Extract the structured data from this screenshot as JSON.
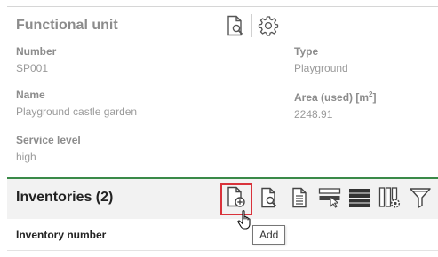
{
  "functional_unit": {
    "title": "Functional unit",
    "fields": {
      "number": {
        "label": "Number",
        "value": "SP001"
      },
      "type": {
        "label": "Type",
        "value": "Playground"
      },
      "name": {
        "label": "Name",
        "value": "Playground castle garden"
      },
      "area": {
        "label": "Area (used) [m",
        "unit_exp": "2",
        "label_suffix": "]",
        "value": "2248.91"
      },
      "service_level": {
        "label": "Service level",
        "value": "high"
      }
    },
    "tools": [
      "search-document-icon",
      "gear-icon"
    ]
  },
  "inventories": {
    "title": "Inventories (2)",
    "toolbar": [
      "add-document-icon",
      "search-document-icon",
      "document-icon",
      "select-rows-icon",
      "list-view-icon",
      "column-settings-icon",
      "filter-icon"
    ],
    "columns": [
      "Inventory number"
    ]
  },
  "tooltip": {
    "text": "Add"
  },
  "colors": {
    "accent_green": "#3a8a48",
    "highlight_red": "#d9333b"
  }
}
